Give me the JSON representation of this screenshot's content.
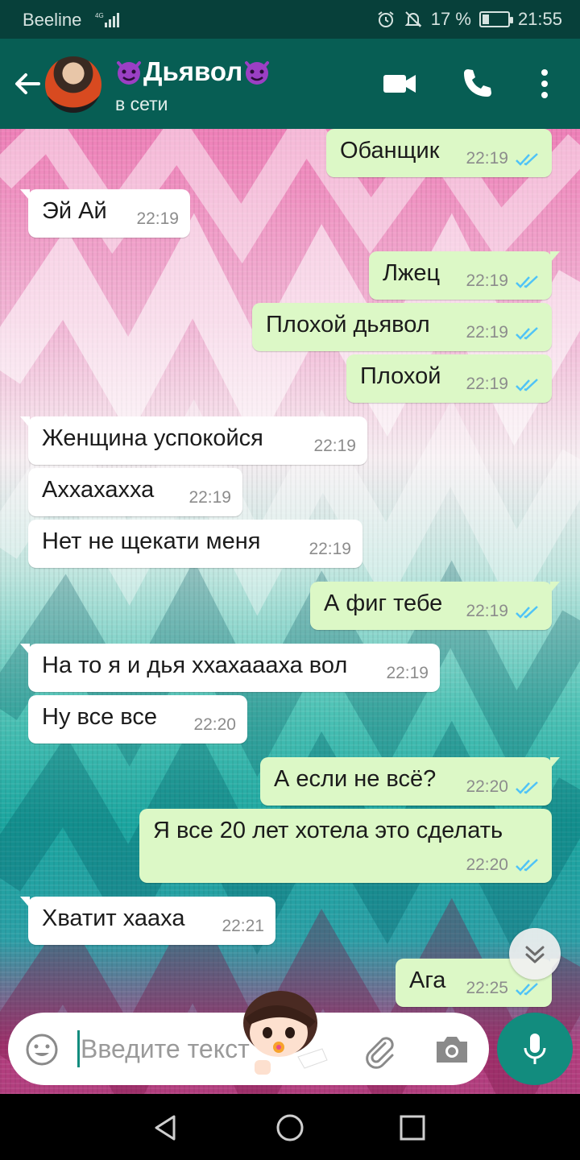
{
  "status_bar": {
    "carrier": "Beeline",
    "network": "4G",
    "battery": "17 %",
    "time": "21:55"
  },
  "header": {
    "contact_name": "Дьявол",
    "contact_status": "в сети"
  },
  "messages": [
    {
      "direction": "out",
      "text": "Обанщик",
      "time": "22:19",
      "status": "read"
    },
    {
      "direction": "in",
      "text": "Эй Ай",
      "time": "22:19"
    },
    {
      "direction": "out",
      "text": "Лжец",
      "time": "22:19",
      "status": "read"
    },
    {
      "direction": "out",
      "text": "Плохой дьявол",
      "time": "22:19",
      "status": "read"
    },
    {
      "direction": "out",
      "text": "Плохой",
      "time": "22:19",
      "status": "read"
    },
    {
      "direction": "in",
      "text": "Женщина успокойся",
      "time": "22:19"
    },
    {
      "direction": "in",
      "text": "Аххахахха",
      "time": "22:19"
    },
    {
      "direction": "in",
      "text": "Нет не щекати меня",
      "time": "22:19"
    },
    {
      "direction": "out",
      "text": "А фиг тебе",
      "time": "22:19",
      "status": "read"
    },
    {
      "direction": "in",
      "text": "На то я и дья ххахаааха вол",
      "time": "22:19"
    },
    {
      "direction": "in",
      "text": "Ну все все",
      "time": "22:20"
    },
    {
      "direction": "out",
      "text": "А если не всё?",
      "time": "22:20",
      "status": "read"
    },
    {
      "direction": "out",
      "text": "Я все 20 лет хотела это сделать",
      "time": "22:20",
      "status": "read"
    },
    {
      "direction": "in",
      "text": "Хватит хааха",
      "time": "22:21"
    },
    {
      "direction": "out",
      "text": "Ага",
      "time": "22:25",
      "status": "read"
    }
  ],
  "compose": {
    "placeholder": "Введите текст"
  },
  "colors": {
    "header": "#075e54",
    "status_bar": "#07403a",
    "outgoing_bubble": "#dcf8c6",
    "incoming_bubble": "#ffffff",
    "read_ticks": "#4fc3f7",
    "accent": "#128c7e"
  },
  "icons": {
    "back": "arrow-left-icon",
    "video": "video-camera-icon",
    "call": "phone-icon",
    "menu": "more-vertical-icon",
    "emoji": "emoji-icon",
    "attach": "paperclip-icon",
    "camera": "camera-icon",
    "mic": "microphone-icon",
    "scroll": "chevron-double-down-icon"
  }
}
